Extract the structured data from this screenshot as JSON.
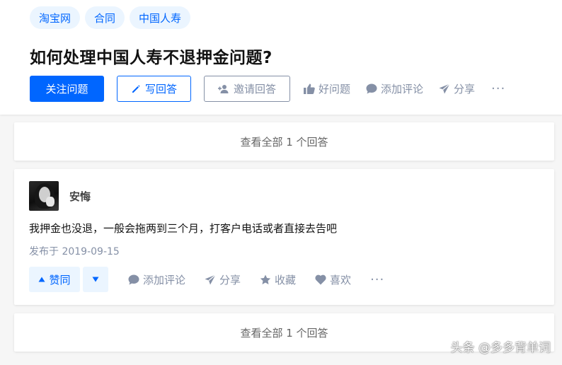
{
  "question": {
    "tags": [
      "淘宝网",
      "合同",
      "中国人寿"
    ],
    "title": "如何处理中国人寿不退押金问题?",
    "actions": {
      "follow": "关注问题",
      "write": "写回答",
      "invite": "邀请回答",
      "good": "好问题",
      "comment": "添加评论",
      "share": "分享",
      "more": "···"
    }
  },
  "view_all_top": "查看全部 1 个回答",
  "answer": {
    "author": "安悔",
    "content": "我押金也没退，一般会拖两到三个月，打客户电话或者直接去告吧",
    "published": "发布于 2019-09-15",
    "actions": {
      "upvote": "赞同",
      "comment": "添加评论",
      "share": "分享",
      "favorite": "收藏",
      "like": "喜欢",
      "more": "···"
    }
  },
  "view_all_bottom": "查看全部 1 个回答",
  "watermark": "头条 @多多背单词",
  "colors": {
    "accent": "#0066ff",
    "accent_bg": "#ebf5ff",
    "meta": "#8590a6"
  }
}
